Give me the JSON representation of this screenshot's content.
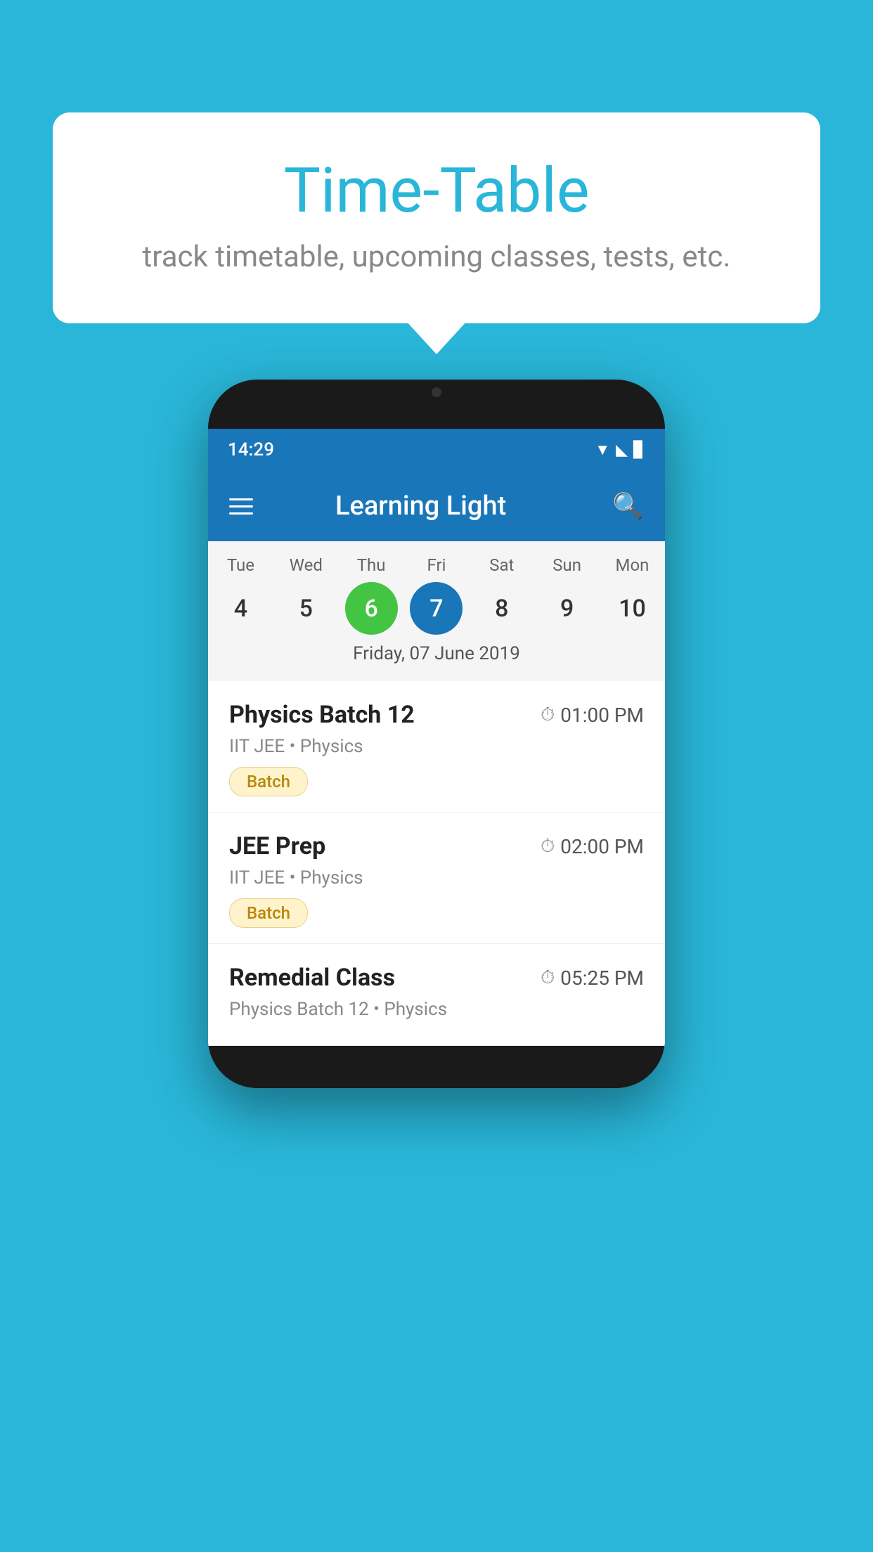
{
  "bubble": {
    "title": "Time-Table",
    "subtitle": "track timetable, upcoming classes, tests, etc."
  },
  "app_bar": {
    "title": "Learning Light"
  },
  "status_bar": {
    "time": "14:29"
  },
  "calendar": {
    "days": [
      {
        "label": "Tue",
        "num": "4",
        "state": "normal"
      },
      {
        "label": "Wed",
        "num": "5",
        "state": "normal"
      },
      {
        "label": "Thu",
        "num": "6",
        "state": "today"
      },
      {
        "label": "Fri",
        "num": "7",
        "state": "selected"
      },
      {
        "label": "Sat",
        "num": "8",
        "state": "normal"
      },
      {
        "label": "Sun",
        "num": "9",
        "state": "normal"
      },
      {
        "label": "Mon",
        "num": "10",
        "state": "normal"
      }
    ],
    "selected_date": "Friday, 07 June 2019"
  },
  "classes": [
    {
      "name": "Physics Batch 12",
      "time": "01:00 PM",
      "meta": "IIT JEE • Physics",
      "tag": "Batch"
    },
    {
      "name": "JEE Prep",
      "time": "02:00 PM",
      "meta": "IIT JEE • Physics",
      "tag": "Batch"
    },
    {
      "name": "Remedial Class",
      "time": "05:25 PM",
      "meta": "Physics Batch 12 • Physics",
      "tag": ""
    }
  ]
}
